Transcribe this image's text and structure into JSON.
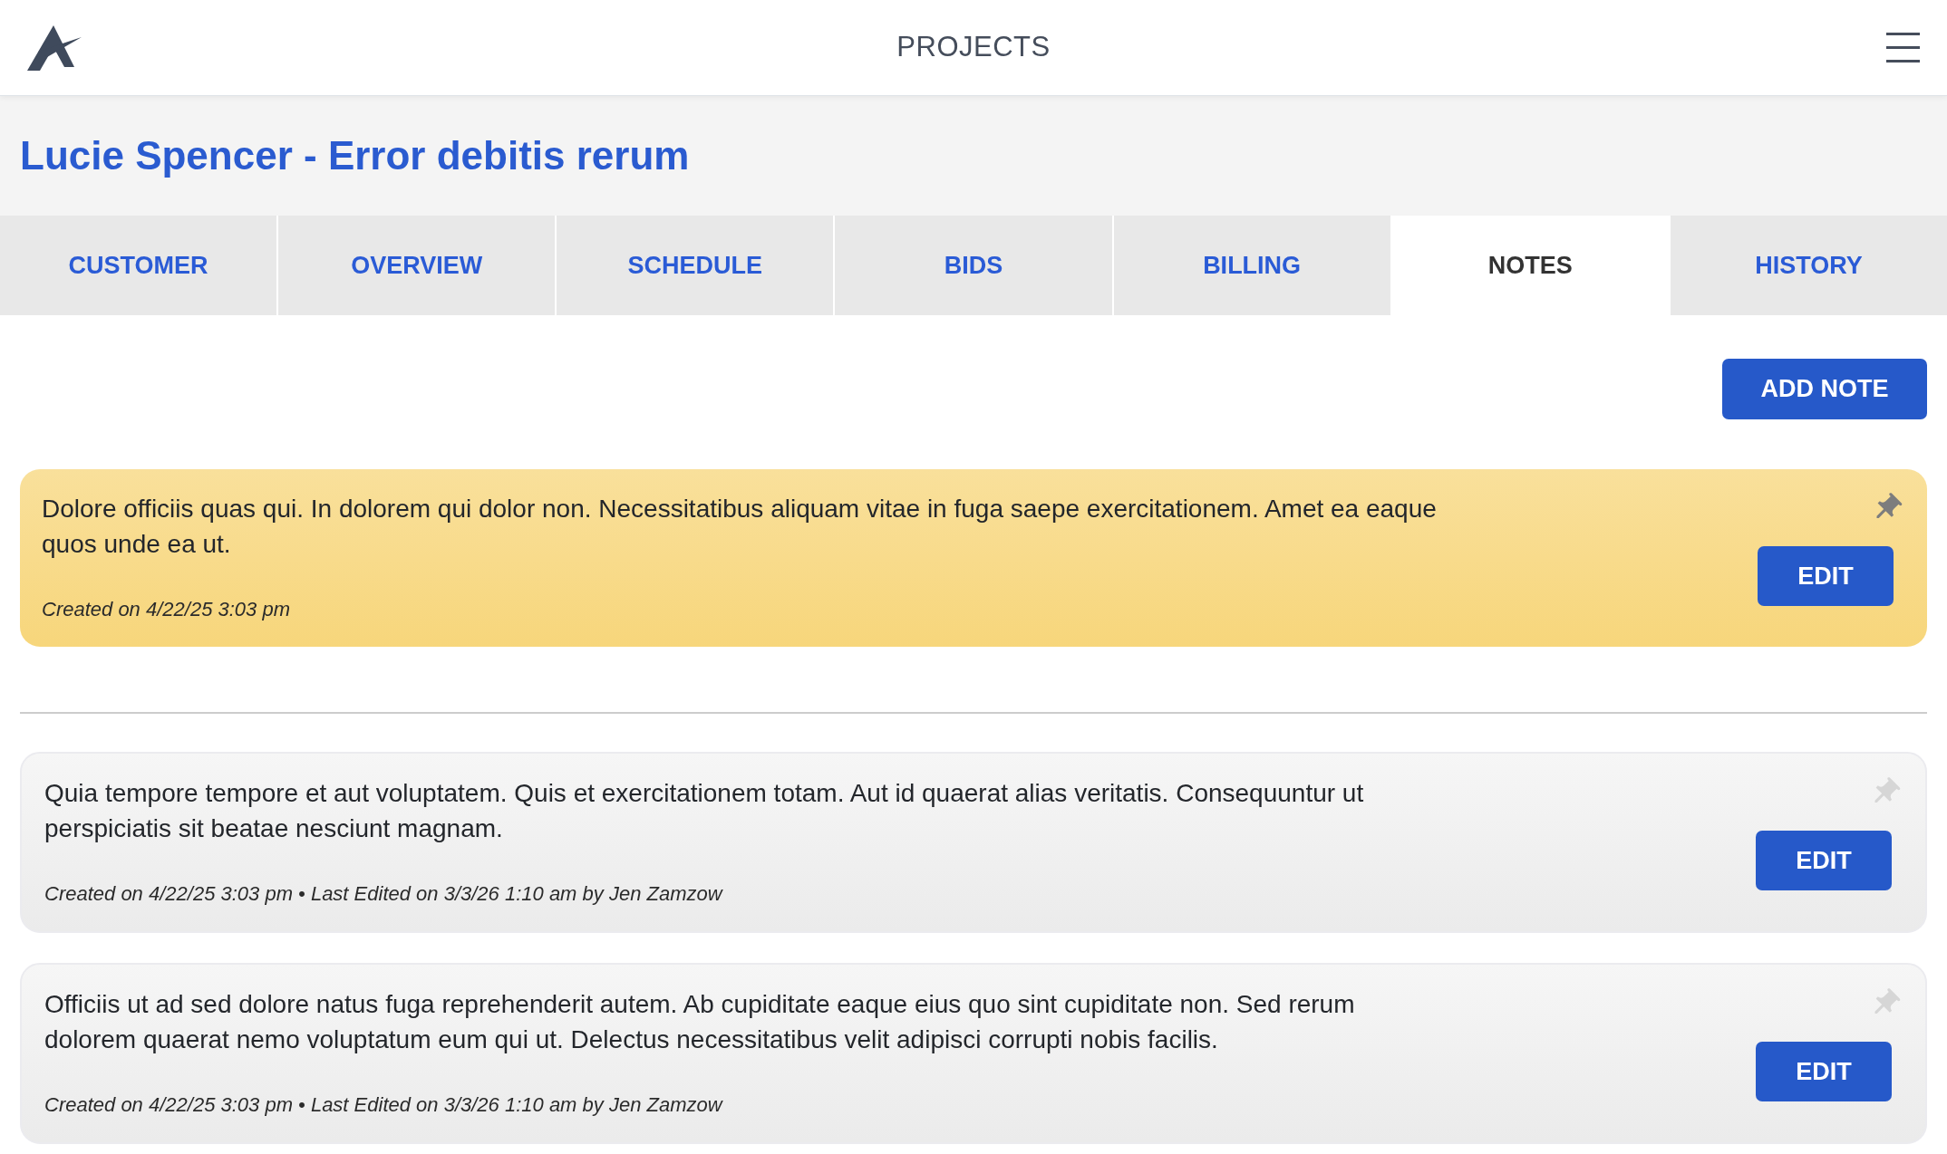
{
  "header": {
    "title": "PROJECTS"
  },
  "project": {
    "title": "Lucie Spencer - Error debitis rerum"
  },
  "tabs": [
    {
      "label": "CUSTOMER",
      "selected": false
    },
    {
      "label": "OVERVIEW",
      "selected": false
    },
    {
      "label": "SCHEDULE",
      "selected": false
    },
    {
      "label": "BIDS",
      "selected": false
    },
    {
      "label": "BILLING",
      "selected": false
    },
    {
      "label": "NOTES",
      "selected": true
    },
    {
      "label": "HISTORY",
      "selected": false
    }
  ],
  "toolbar": {
    "add_button": "ADD NOTE"
  },
  "notes": [
    {
      "text": "Dolore officiis quas qui. In dolorem qui dolor non. Necessitatibus aliquam vitae in fuga saepe exercitationem. Amet ea eaque quos unde ea ut.",
      "meta": "Created on 4/22/25 3:03 pm",
      "pinned": true,
      "edit_button": "EDIT"
    },
    {
      "text": "Quia tempore tempore et aut voluptatem. Quis et exercitationem totam. Aut id quaerat alias veritatis. Consequuntur ut perspiciatis sit beatae nesciunt magnam.",
      "meta": "Created on 4/22/25 3:03 pm • Last Edited on 3/3/26 1:10 am by Jen Zamzow",
      "pinned": false,
      "edit_button": "EDIT"
    },
    {
      "text": "Officiis ut ad sed dolore natus fuga reprehenderit autem. Ab cupiditate eaque eius quo sint cupiditate non. Sed rerum dolorem quaerat nemo voluptatum eum qui ut. Delectus necessitatibus velit adipisci corrupti nobis facilis.",
      "meta": "Created on 4/22/25 3:03 pm • Last Edited on 3/3/26 1:10 am by Jen Zamzow",
      "pinned": false,
      "edit_button": "EDIT"
    }
  ]
}
